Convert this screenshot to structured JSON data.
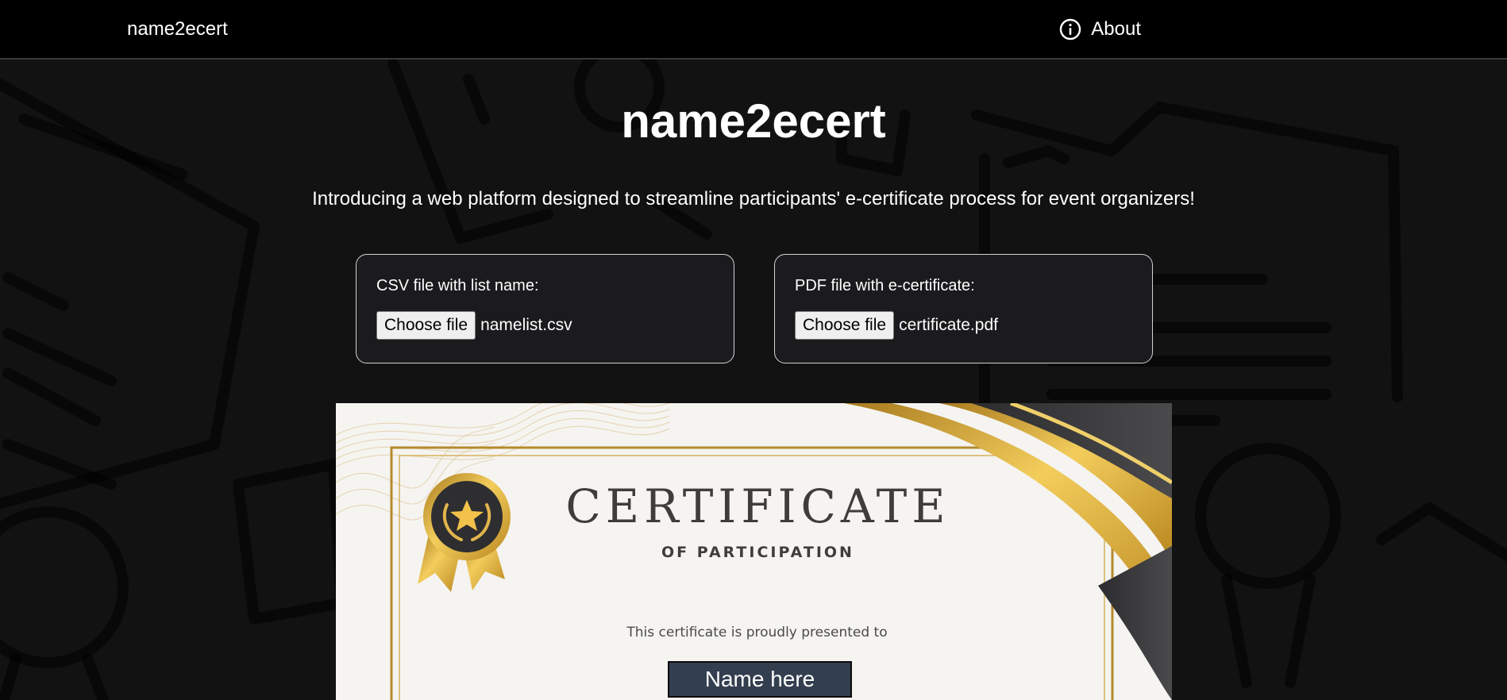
{
  "navbar": {
    "brand": "name2ecert",
    "about_label": "About",
    "about_icon": "info-circle-icon"
  },
  "hero": {
    "title": "name2ecert",
    "intro": "Introducing a web platform designed to streamline participants' e-certificate process for event organizers!"
  },
  "uploads": {
    "csv": {
      "label": "CSV file with list name:",
      "button_label": "Choose file",
      "file_name": "namelist.csv"
    },
    "pdf": {
      "label": "PDF file with e-certificate:",
      "button_label": "Choose file",
      "file_name": "certificate.pdf"
    }
  },
  "certificate": {
    "title": "CERTIFICATE",
    "subtitle": "OF PARTICIPATION",
    "presented_text": "This certificate is proudly presented to",
    "name_placeholder": "Name here",
    "badge_icon": "medal-star-icon"
  },
  "colors": {
    "background": "#121213",
    "navbar": "#000000",
    "card": "#1b1b1e",
    "gold": "#d9a93b",
    "name_box": "#333e4f"
  }
}
